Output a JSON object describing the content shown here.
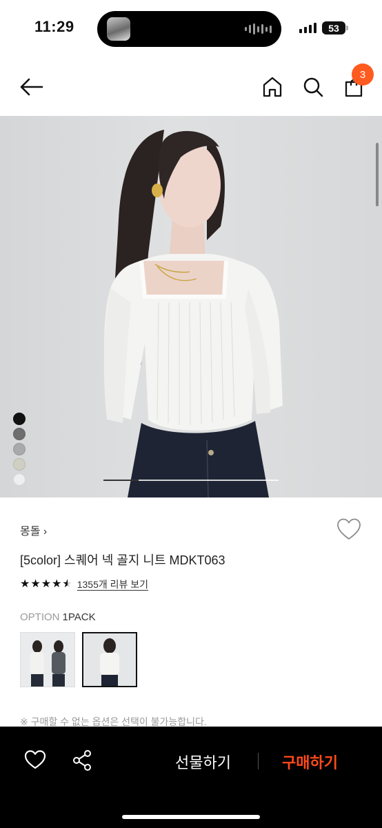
{
  "status_bar": {
    "time": "11:29",
    "battery": "53"
  },
  "nav": {
    "cart_count": "3"
  },
  "product": {
    "image_index": 1,
    "image_count": 5,
    "swatches": [
      "#111111",
      "#6e6e6e",
      "#a9a9a9",
      "#cfcfc4",
      "#efefef"
    ],
    "brand": "몽돌",
    "brand_chevron": "›",
    "title": "[5color] 스퀘어 넥 골지 니트 MDKT063",
    "rating_value": 4.5,
    "rating_stars": "★★★★★",
    "review_link": "1355개 리뷰 보기"
  },
  "option": {
    "label": "OPTION",
    "value": "1PACK",
    "selected_index": 1
  },
  "notice": "※ 구매할 수 없는 옵션은 선택이 불가능합니다.",
  "bottom_bar": {
    "gift_label": "선물하기",
    "buy_label": "구매하기"
  },
  "colors": {
    "accent": "#ff5a1f",
    "buy": "#ff4a1c"
  }
}
